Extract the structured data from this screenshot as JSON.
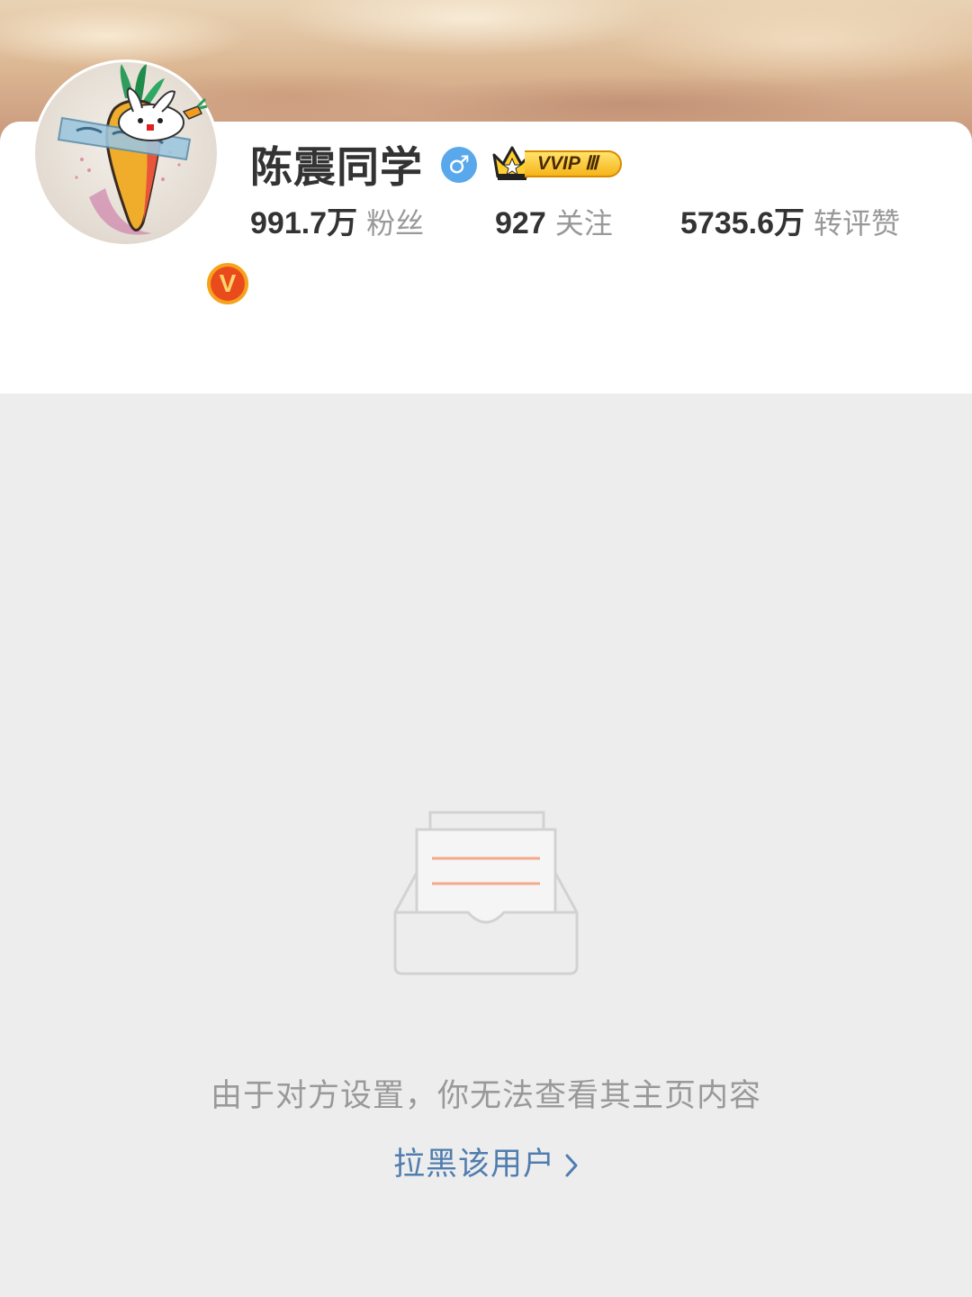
{
  "profile": {
    "name": "陈震同学",
    "gender_symbol": "♂",
    "verified_badge": "V",
    "vip_label": "VVIP Ⅲ",
    "cover_image": "sand-dune-cover",
    "avatar_image": "carrot-tattoo-avatar"
  },
  "stats": [
    {
      "value": "991.7万",
      "label": "粉丝"
    },
    {
      "value": "927",
      "label": "关注"
    },
    {
      "value": "5735.6万",
      "label": "转评赞"
    }
  ],
  "empty_state": {
    "icon": "empty-inbox-icon",
    "message": "由于对方设置，你无法查看其主页内容",
    "action_label": "拉黑该用户"
  },
  "colors": {
    "page_background": "#ededed",
    "card_background": "#ffffff",
    "link": "#507daf",
    "muted_text": "#999999",
    "primary_text": "#333333",
    "gender_blue": "#5aa8ec",
    "vip_gold": "#f6b51a",
    "verified_orange": "#ea4b1c"
  }
}
